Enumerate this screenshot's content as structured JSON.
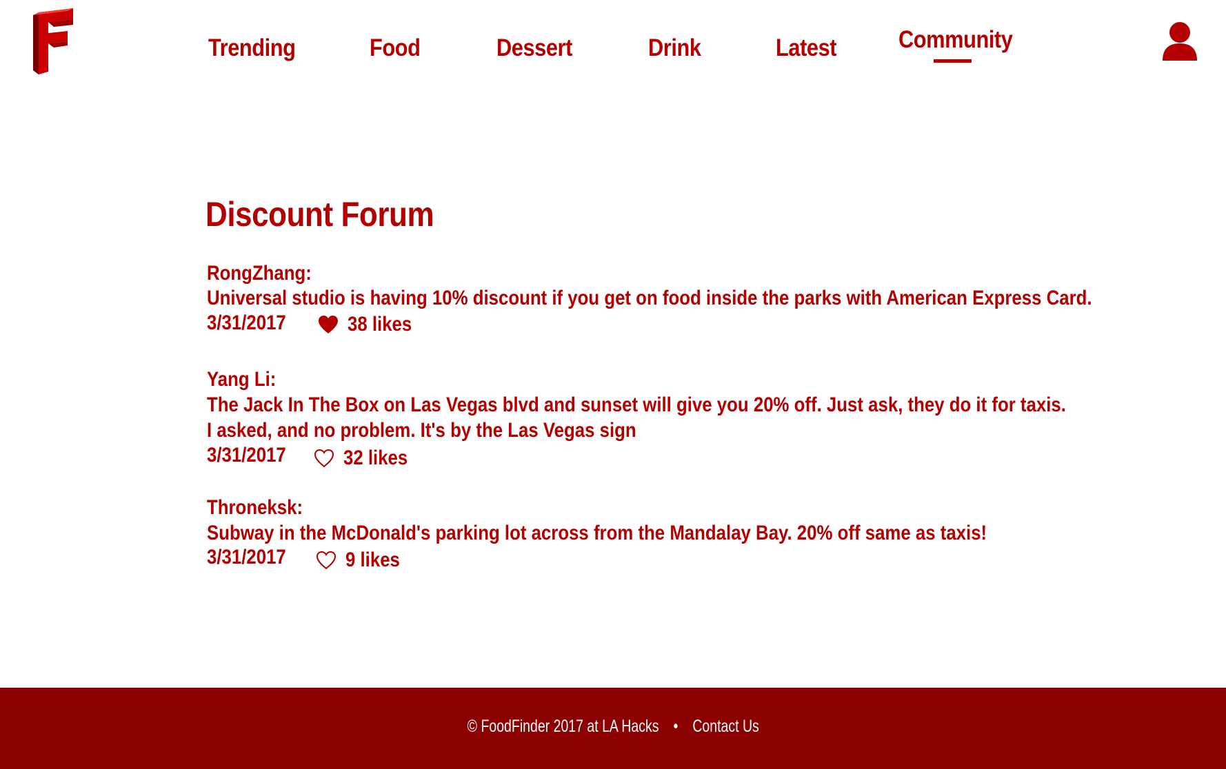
{
  "header": {
    "logo_letter": "F",
    "nav": [
      {
        "label": "Trending"
      },
      {
        "label": "Food"
      },
      {
        "label": "Dessert"
      },
      {
        "label": "Drink"
      },
      {
        "label": "Latest"
      },
      {
        "label": "Community",
        "active": true
      }
    ],
    "user_icon": "user-icon"
  },
  "main": {
    "title": "Discount Forum",
    "posts": [
      {
        "author": "RongZhang:",
        "lines": [
          "Universal studio is having 10% discount if you get on food inside the parks with American Express Card."
        ],
        "date": "3/31/2017",
        "likes": "38 likes",
        "liked": true
      },
      {
        "author": "Yang Li:",
        "lines": [
          "The Jack In The Box on Las Vegas blvd and sunset will give you 20% off. Just ask, they do it for taxis.",
          "I asked, and no problem. It's by the Las Vegas sign"
        ],
        "date": "3/31/2017",
        "likes": "32 likes",
        "liked": false
      },
      {
        "author": "Throneksk:",
        "lines": [
          "Subway in the McDonald's parking lot across from the Mandalay Bay. 20% off same as taxis!"
        ],
        "date": "3/31/2017",
        "likes": "9 likes",
        "liked": false
      }
    ]
  },
  "footer": {
    "copyright": "© FoodFinder 2017 at LA Hacks",
    "separator": "•",
    "contact": "Contact Us"
  },
  "colors": {
    "accent": "#b30000",
    "footer_bg": "#8b0000",
    "footer_text": "#ffffff"
  }
}
